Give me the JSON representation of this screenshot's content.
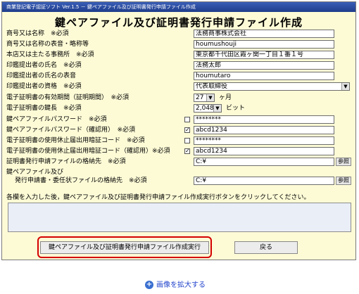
{
  "window": {
    "title": "商業登記電子認証ソフト Ver.1.5 － 鍵ペアファイル及び証明書発行申請ファイル作成",
    "heading": "鍵ペアファイル及び証明書発行申請ファイル作成"
  },
  "fields": {
    "company_name": {
      "label": "商号又は名称　※必須",
      "value": "法務商事株式会社"
    },
    "company_kana": {
      "label": "商号又は名称の表音・略称等",
      "value": "houmushouji"
    },
    "address": {
      "label": "本店又は主たる事務所　※必須",
      "value": "東京都千代田区霞ヶ関一丁目１番１号"
    },
    "seal_name": {
      "label": "印鑑提出者の氏名　※必須",
      "value": "法務太郎"
    },
    "seal_name_kana": {
      "label": "印鑑提出者の氏名の表音",
      "value": "houmutaro"
    },
    "seal_title": {
      "label": "印鑑提出者の資格　※必須",
      "value": "代表取締役"
    },
    "validity": {
      "label": "電子証明書の有効期間（証明期間）　※必須",
      "value": "27",
      "unit": "ヶ月"
    },
    "key_length": {
      "label": "電子証明書の鍵長　※必須",
      "value": "2,048",
      "unit": "ビット"
    },
    "key_password": {
      "label": "鍵ペアファイルパスワード　※必須",
      "value": "********",
      "checked": false
    },
    "key_password_confirm": {
      "label": "鍵ペアファイルパスワード（確認用）　※必須",
      "value": "abcd1234",
      "checked": true
    },
    "suspend_code": {
      "label": "電子証明書の使用休止届出用暗証コード　※必須",
      "value": "********",
      "checked": false
    },
    "suspend_code_confirm": {
      "label": "電子証明書の使用休止届出用暗証コード（確認用）※必須",
      "value": "abcd1234",
      "checked": true
    },
    "request_dir": {
      "label": "証明書発行申請ファイルの格納先　※必須",
      "value": "C:¥",
      "button": "参照"
    },
    "key_dir": {
      "label1": "鍵ペアファイル及び",
      "label2": "発行申請書・委任状ファイルの格納先　※必須",
      "value": "C:¥",
      "button": "参照"
    }
  },
  "instruction": "各欄を入力した後，鍵ペアファイル及び証明書発行申請ファイル作成実行ボタンをクリックしてください。",
  "buttons": {
    "execute": "鍵ペアファイル及び証明書発行申請ファイル作成実行",
    "back": "戻る"
  },
  "footer": {
    "zoom_link": "画像を拡大する"
  },
  "colors": {
    "window_bg": "#fdfbd6",
    "titlebar": "#1e3c8a",
    "highlight": "#d40000"
  }
}
